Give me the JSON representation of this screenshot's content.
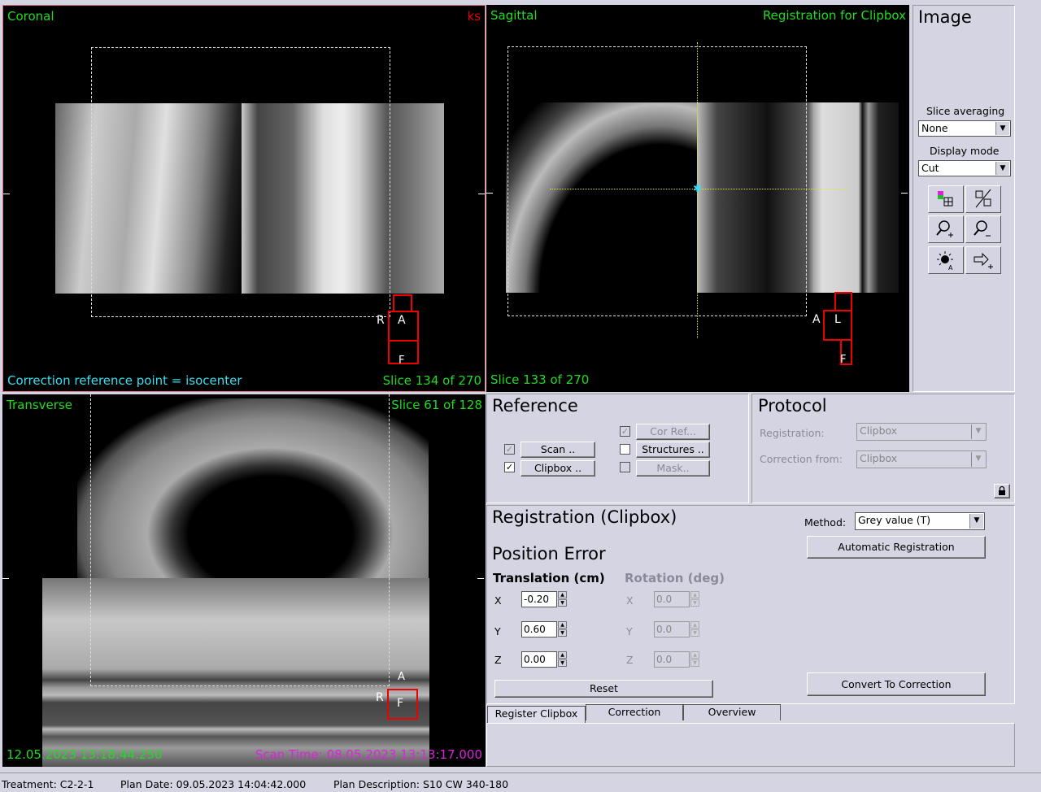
{
  "viewports": {
    "coronal": {
      "title": "Coronal",
      "user_tag": "ks",
      "bottom_left": "Correction reference point = isocenter",
      "slice": "Slice 134 of 270"
    },
    "sagittal": {
      "title": "Sagittal",
      "top_right": "Registration for Clipbox",
      "slice": "Slice 133 of 270"
    },
    "transverse": {
      "title": "Transverse",
      "slice": "Slice 61 of 128",
      "timestamp": "12.05.2023 13:18:44.250",
      "scan_time": "Scan Time: 08.05.2023 13:13:17.000"
    }
  },
  "orientation": {
    "coronal_left": "R",
    "coronal_box": "A",
    "coronal_bottom": "F",
    "sagittal_left": "A",
    "sagittal_box": "L",
    "sagittal_bottom": "F",
    "transverse_top": "A",
    "transverse_left": "R",
    "transverse_box": "F"
  },
  "image_panel": {
    "title": "Image",
    "slice_averaging_label": "Slice averaging",
    "slice_averaging_value": "None",
    "display_mode_label": "Display mode",
    "display_mode_value": "Cut",
    "tools": [
      "image-blend-icon",
      "split-view-icon",
      "zoom-in-icon",
      "zoom-out-icon",
      "auto-contrast-icon",
      "pan-icon"
    ]
  },
  "reference": {
    "title": "Reference",
    "scan": "Scan ..",
    "clipbox": "Clipbox ..",
    "cor_ref": "Cor Ref...",
    "structures": "Structures ..",
    "mask": "Mask..",
    "scan_checked": true,
    "clipbox_checked": true,
    "cor_ref_checked": true
  },
  "protocol": {
    "title": "Protocol",
    "registration_label": "Registration:",
    "registration_value": "Clipbox",
    "correction_label": "Correction from:",
    "correction_value": "Clipbox"
  },
  "registration": {
    "title": "Registration (Clipbox)",
    "method_label": "Method:",
    "method_value": "Grey value (T)",
    "auto_button": "Automatic Registration",
    "position_error": "Position Error",
    "translation_header": "Translation (cm)",
    "rotation_header": "Rotation (deg)",
    "x_label": "X",
    "y_label": "Y",
    "z_label": "Z",
    "tx": "-0.20",
    "ty": "0.60",
    "tz": "0.00",
    "rx": "0.0",
    "ry": "0.0",
    "rz": "0.0",
    "reset_button": "Reset",
    "convert_button": "Convert To Correction"
  },
  "tabs": [
    "Register Clipbox",
    "Correction",
    "Overview"
  ],
  "status": {
    "treatment": "Treatment: C2-2-1",
    "plan_date": "Plan Date: 09.05.2023 14:04:42.000",
    "plan_description": "Plan Description: S10 CW 340-180"
  },
  "colors": {
    "green": "#1fdc1f",
    "cyan": "#35e0f0",
    "magenta": "#e020e0",
    "red": "#e00000",
    "panel": "#d4d4e2"
  }
}
